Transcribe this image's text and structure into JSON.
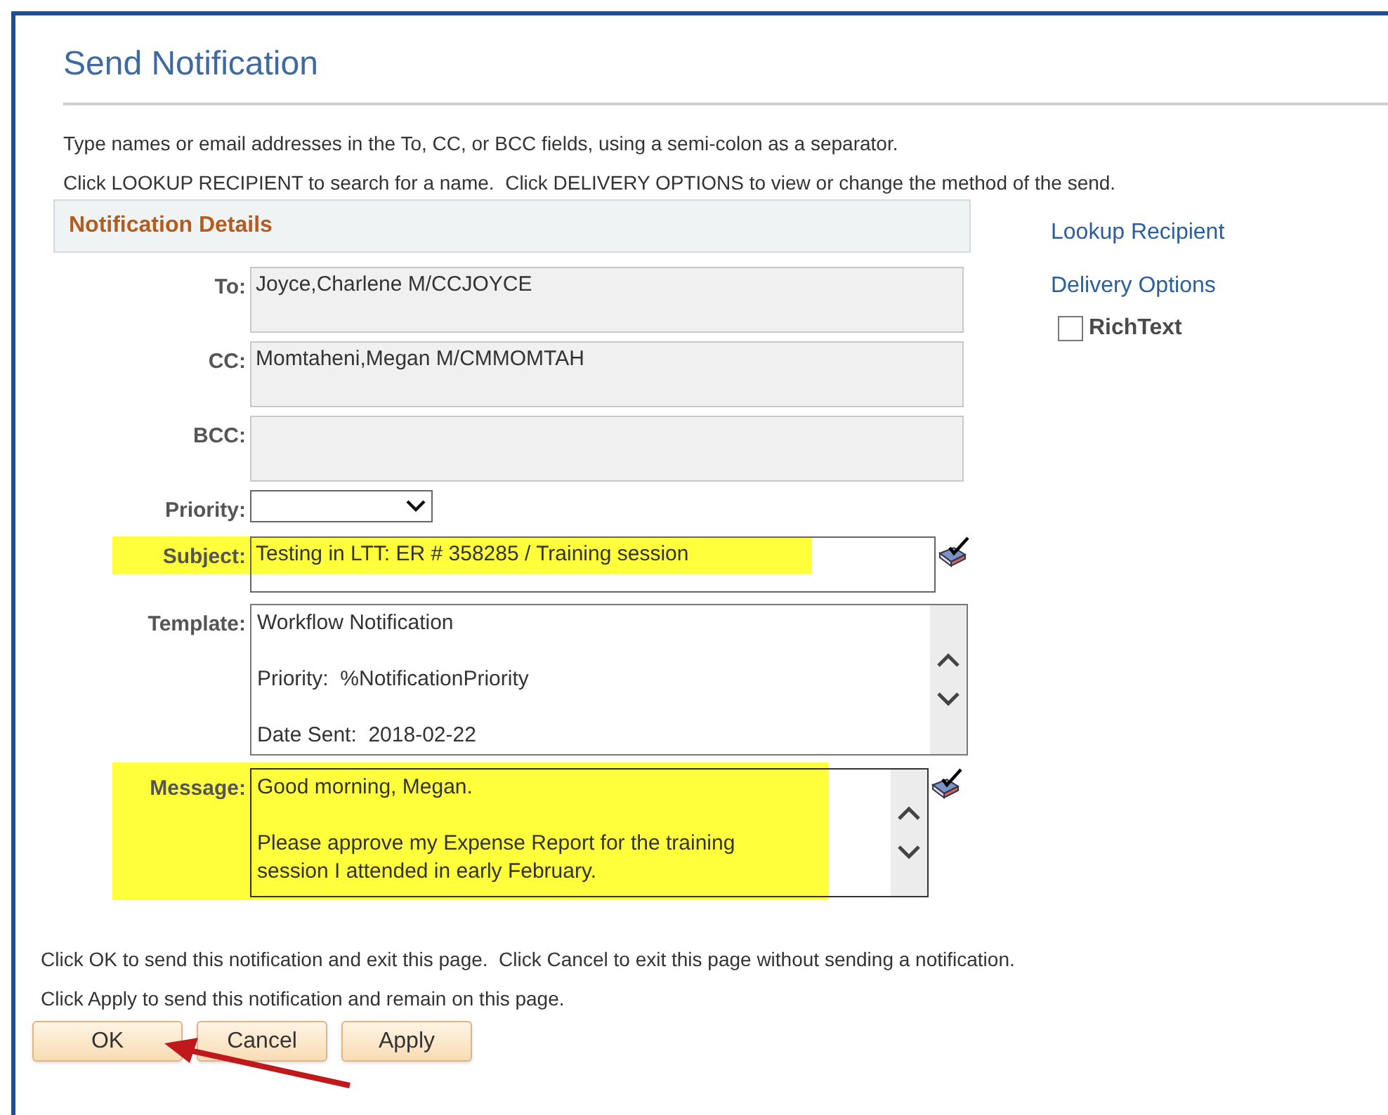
{
  "page_title": "Send Notification",
  "instructions": [
    "Type names or email addresses in the To, CC, or BCC fields, using a semi-colon as a separator.",
    "Click LOOKUP RECIPIENT to search for a name.  Click DELIVERY OPTIONS to view or change the method of the send."
  ],
  "section": {
    "title": "Notification Details"
  },
  "fields": [
    {
      "kind": "text",
      "label": "To:",
      "paragraphs": [
        "Joyce,Charlene M/CCJOYCE"
      ],
      "highlighted": false,
      "spell_check": false
    },
    {
      "kind": "text",
      "label": "CC:",
      "paragraphs": [
        "Momtaheni,Megan M/CMMOMTAH"
      ],
      "highlighted": false,
      "spell_check": false
    },
    {
      "kind": "text",
      "label": "BCC:",
      "highlighted": false,
      "spell_check": false
    },
    {
      "kind": "select",
      "label": "Priority:",
      "highlighted": false,
      "spell_check": false
    },
    {
      "kind": "line",
      "label": "Subject:",
      "paragraphs": [
        "Testing in LTT: ER # 358285 / Training session"
      ],
      "highlighted": true,
      "spell_check": true
    },
    {
      "kind": "scroll",
      "label": "Template:",
      "paragraphs": [
        "Workflow Notification",
        "Priority:  %NotificationPriority",
        "Date Sent:  2018-02-22"
      ],
      "highlighted": false,
      "spell_check": false
    },
    {
      "kind": "scroll",
      "label": "Message:",
      "paragraphs": [
        "Good morning, Megan.",
        "Please approve my Expense Report for the training session I attended in early February."
      ],
      "highlighted": true,
      "spell_check": true
    }
  ],
  "links": [
    "Lookup Recipient",
    "Delivery Options"
  ],
  "rich_text": {
    "label": "RichText",
    "checked": false
  },
  "footer_text": [
    "Click OK to send this notification and exit this page.  Click Cancel to exit this page without sending a notification.",
    "Click Apply to send this notification and remain on this page."
  ],
  "buttons": [
    "OK",
    "Cancel",
    "Apply"
  ]
}
